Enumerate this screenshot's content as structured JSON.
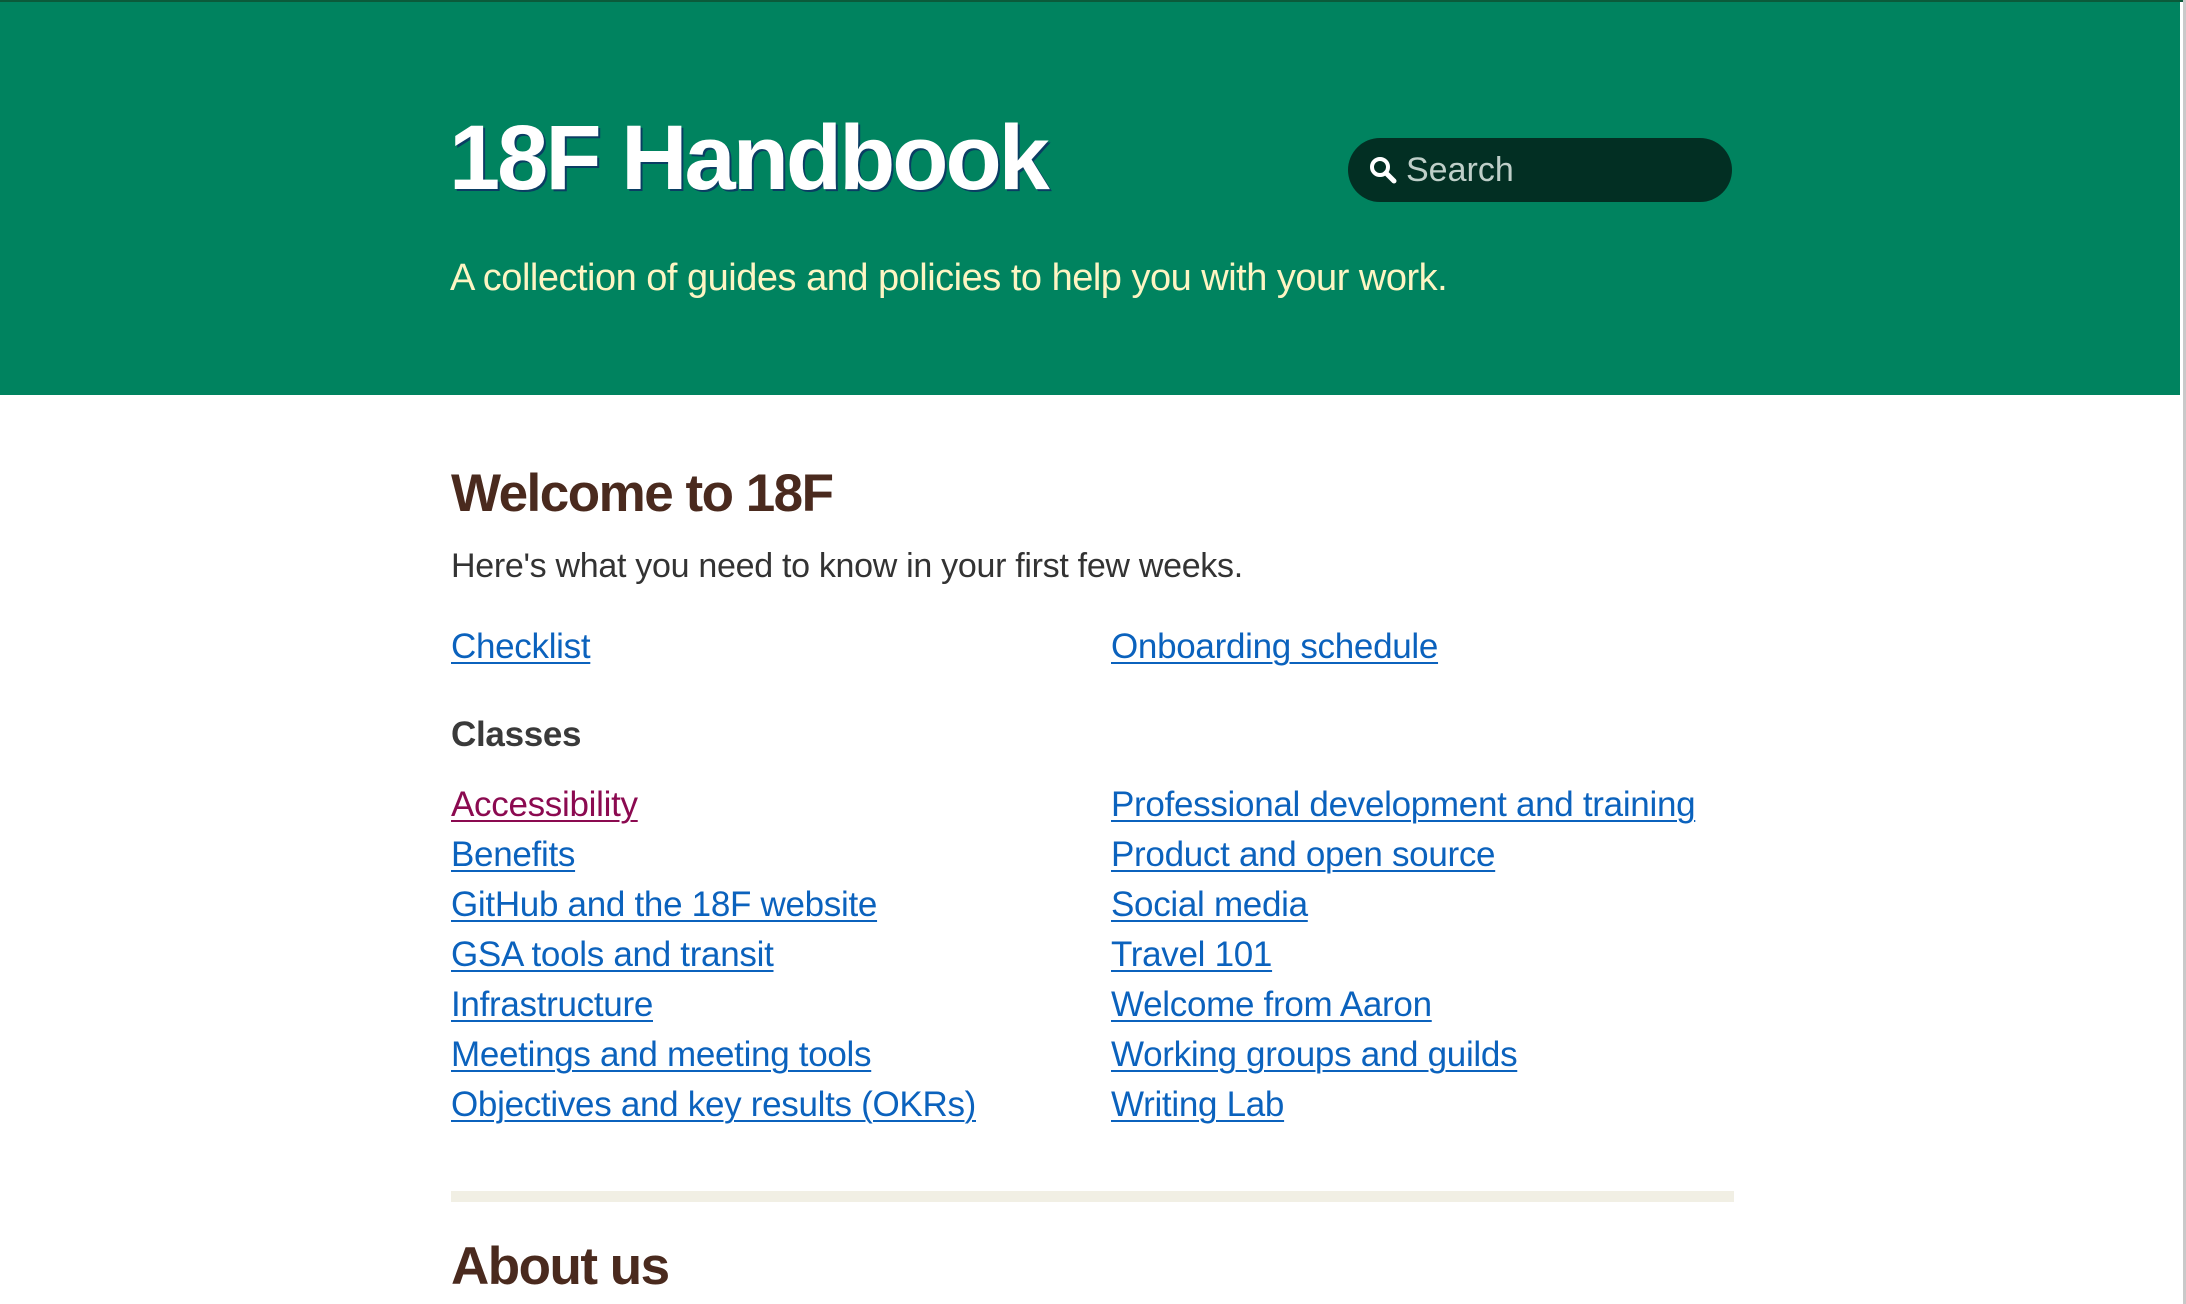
{
  "header": {
    "title": "18F Handbook",
    "tagline": "A collection of guides and policies to help you with your work.",
    "background_color": "#00835f",
    "tagline_color": "#fdf5c3"
  },
  "search": {
    "placeholder": "Search",
    "icon": "search-icon"
  },
  "welcome": {
    "heading": "Welcome to 18F",
    "intro": "Here's what you need to know in your first few weeks.",
    "links": [
      {
        "label": "Checklist"
      },
      {
        "label": "Onboarding schedule"
      }
    ]
  },
  "classes": {
    "heading": "Classes",
    "left": [
      {
        "label": "Accessibility",
        "visited": true
      },
      {
        "label": "Benefits"
      },
      {
        "label": "GitHub and the 18F website"
      },
      {
        "label": "GSA tools and transit"
      },
      {
        "label": "Infrastructure"
      },
      {
        "label": "Meetings and meeting tools"
      },
      {
        "label": "Objectives and key results (OKRs)"
      }
    ],
    "right": [
      {
        "label": "Professional development and training"
      },
      {
        "label": "Product and open source"
      },
      {
        "label": "Social media"
      },
      {
        "label": "Travel 101"
      },
      {
        "label": "Welcome from Aaron"
      },
      {
        "label": "Working groups and guilds"
      },
      {
        "label": "Writing Lab"
      }
    ]
  },
  "about": {
    "heading": "About us"
  },
  "colors": {
    "link": "#0b62bd",
    "visited_link": "#8b0a50",
    "heading": "#4a2a1e"
  }
}
